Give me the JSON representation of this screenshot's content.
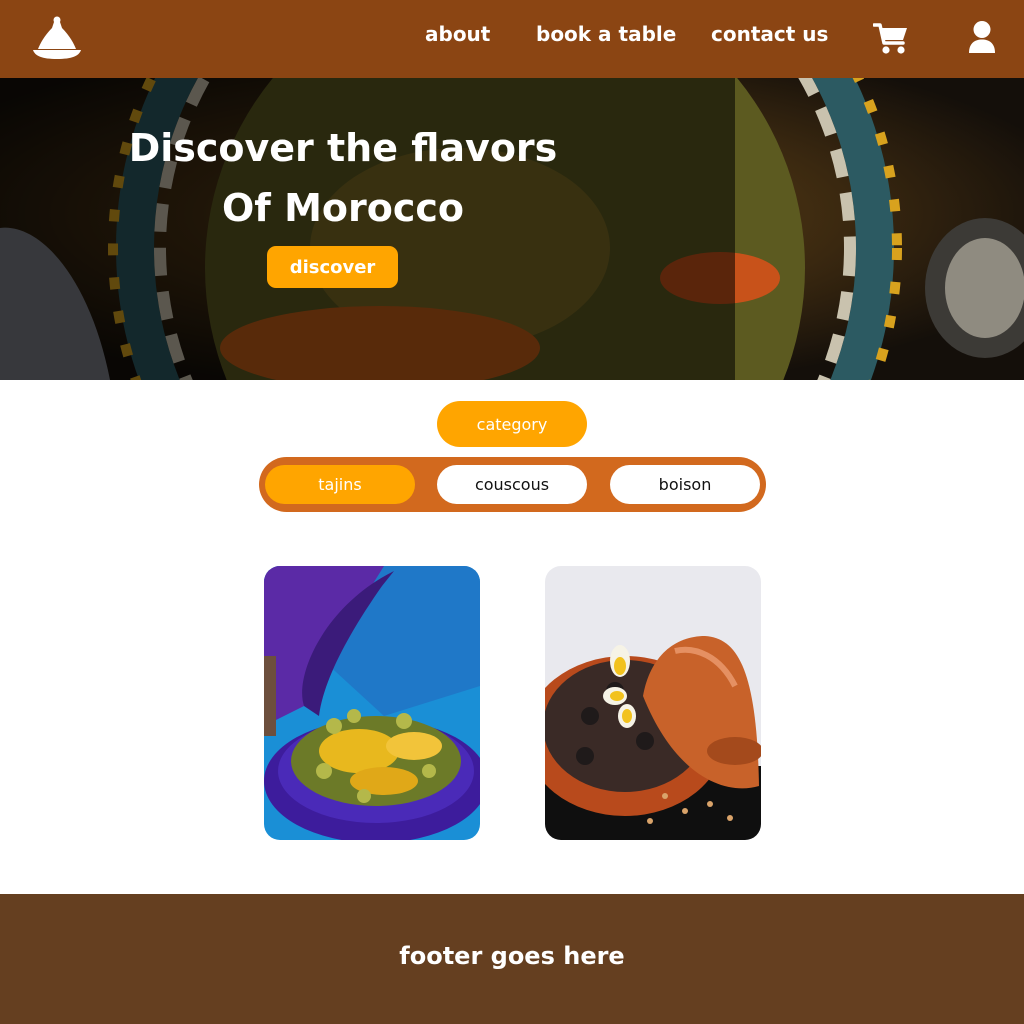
{
  "header": {
    "logo_icon": "tagine-icon",
    "nav": {
      "about": "about",
      "book": "book a table",
      "contact": "contact us"
    },
    "cart_icon": "cart-icon",
    "user_icon": "user-icon",
    "bg_color": "#8B4513"
  },
  "hero": {
    "title_line1": "Discover the flavors",
    "title_line2": "Of Morocco",
    "cta_label": "discover",
    "accent": "#FFA500"
  },
  "category": {
    "label": "category",
    "tabs": [
      {
        "label": "tajins",
        "active": true
      },
      {
        "label": "couscous",
        "active": false
      },
      {
        "label": "boison",
        "active": false
      }
    ],
    "tab_bar_color": "#D2691E"
  },
  "dishes": [
    {
      "image": "chicken-tagine-with-olives-and-lemon"
    },
    {
      "image": "lamb-tagine-with-prunes-eggs-and-almonds"
    }
  ],
  "footer": {
    "text": "footer goes here",
    "bg_color": "#653f20"
  }
}
